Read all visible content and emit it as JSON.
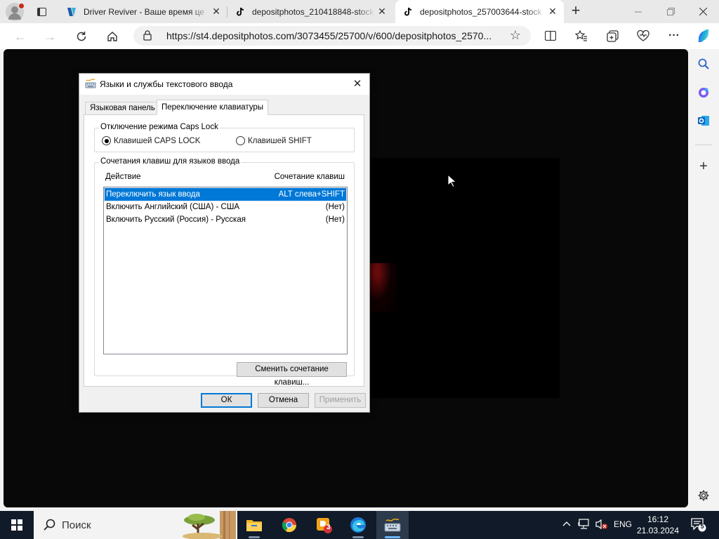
{
  "browser": {
    "tabs": [
      {
        "title": "Driver Reviver - Ваше время це",
        "favicon": "driver-reviver-logo"
      },
      {
        "title": "depositphotos_210418848-stock",
        "favicon": "tiktok-logo"
      },
      {
        "title": "depositphotos_257003644-stock",
        "favicon": "tiktok-logo"
      }
    ],
    "url": "https://st4.depositphotos.com/3073455/25700/v/600/depositphotos_2570..."
  },
  "dialog": {
    "title": "Языки и службы текстового ввода",
    "tabs": [
      "Языковая панель",
      "Переключение клавиатуры"
    ],
    "capslock": {
      "legend": "Отключение режима Caps Lock",
      "option_capslock": "Клавишей CAPS LOCK",
      "option_shift": "Клавишей SHIFT",
      "selected": "capslock"
    },
    "hotkeys": {
      "legend": "Сочетания клавиш для языков ввода",
      "col_action": "Действие",
      "col_combo": "Сочетание клавиш",
      "rows": [
        {
          "action": "Переключить язык ввода",
          "combo": "ALT слева+SHIFT"
        },
        {
          "action": "Включить Английский (США) - США",
          "combo": "(Нет)"
        },
        {
          "action": "Включить Русский (Россия) - Русская",
          "combo": "(Нет)"
        }
      ],
      "change_button": "Сменить сочетание клавиш..."
    },
    "ok": "ОК",
    "cancel": "Отмена",
    "apply": "Применить"
  },
  "taskbar": {
    "search_placeholder": "Поиск",
    "badge_count": "3",
    "language": "ENG",
    "time": "16:12",
    "date": "21.03.2024",
    "notification_count": "5"
  },
  "colors": {
    "accent": "#0078d7",
    "taskbar": "#101a28",
    "content_bg": "#080808"
  }
}
